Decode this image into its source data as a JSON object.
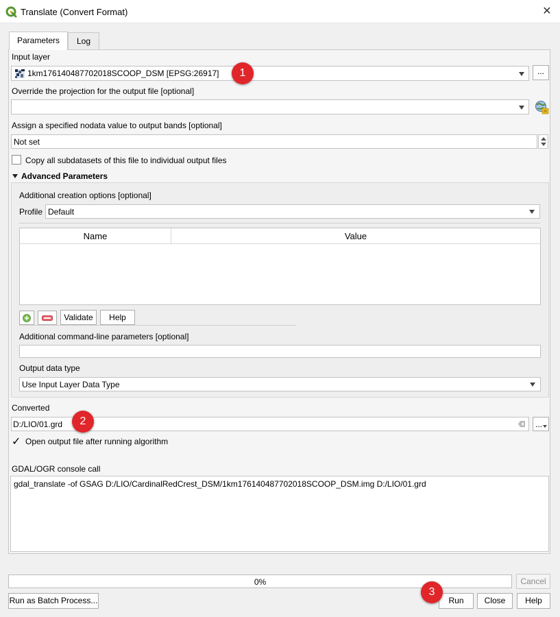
{
  "window": {
    "title": "Translate (Convert Format)"
  },
  "tabs": [
    {
      "label": "Parameters"
    },
    {
      "label": "Log"
    }
  ],
  "input_layer": {
    "label": "Input layer",
    "value": "1km176140487702018SCOOP_DSM [EPSG:26917]",
    "more_label": "..."
  },
  "projection": {
    "label": "Override the projection for the output file [optional]",
    "value": ""
  },
  "nodata": {
    "label": "Assign a specified nodata value to output bands [optional]",
    "value": "Not set"
  },
  "copy_subdatasets": {
    "label": "Copy all subdatasets of this file to individual output files",
    "checked": false
  },
  "advanced": {
    "label": "Advanced Parameters",
    "creation_options_label": "Additional creation options [optional]",
    "profile_label": "Profile",
    "profile_value": "Default",
    "table_headers": {
      "name": "Name",
      "value": "Value"
    },
    "validate_label": "Validate",
    "help_label": "Help",
    "cmdline_label": "Additional command-line parameters [optional]",
    "cmdline_value": "",
    "output_type_label": "Output data type",
    "output_type_value": "Use Input Layer Data Type"
  },
  "converted": {
    "label": "Converted",
    "value": "D:/LIO/01.grd",
    "more_label": "..."
  },
  "open_output": {
    "label": "Open output file after running algorithm",
    "checked": true,
    "check_glyph": "✓"
  },
  "console": {
    "label": "GDAL/OGR console call",
    "text": "gdal_translate -of GSAG D:/LIO/CardinalRedCrest_DSM/1km176140487702018SCOOP_DSM.img D:/LIO/01.grd"
  },
  "progress": {
    "text": "0%",
    "fraction": 0
  },
  "buttons": {
    "cancel": "Cancel",
    "batch": "Run as Batch Process...",
    "run": "Run",
    "close": "Close",
    "help": "Help"
  },
  "annotations": [
    "1",
    "2",
    "3"
  ],
  "colors": {
    "badge": "#e0262a",
    "accent_green": "#589632",
    "remove_red": "#d9363e"
  },
  "icons": {
    "app": "qgis-logo-icon",
    "close": "close-icon",
    "layer": "raster-layer-icon",
    "crs": "crs-globe-icon",
    "add": "add-icon",
    "remove": "remove-icon"
  }
}
